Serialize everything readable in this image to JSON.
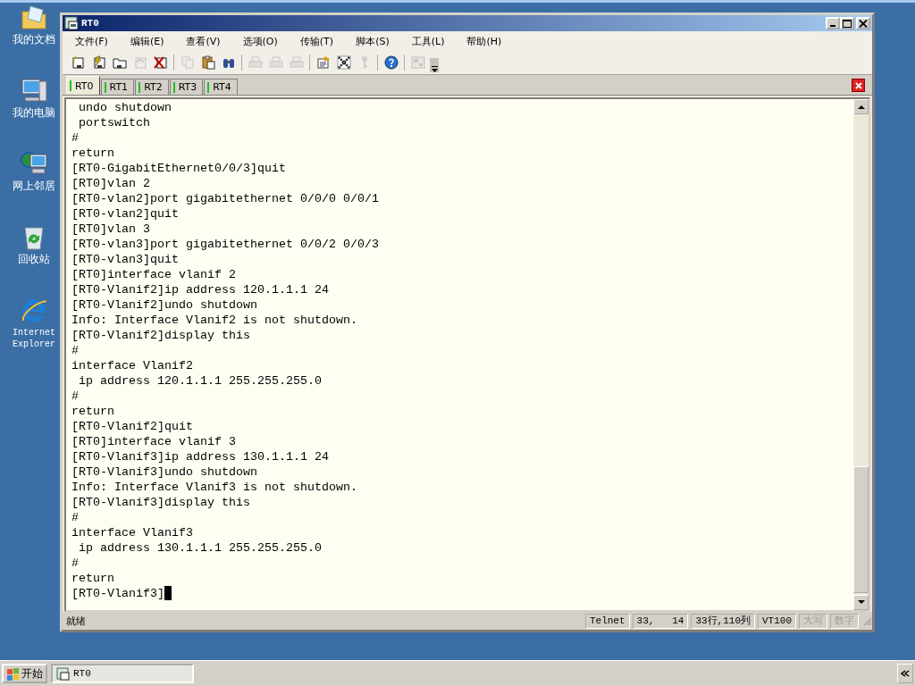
{
  "desktop_icons": [
    {
      "kind": "documents",
      "label": "我的文档"
    },
    {
      "kind": "computer",
      "label": "我的电脑"
    },
    {
      "kind": "network",
      "label": "网上邻居"
    },
    {
      "kind": "recycle",
      "label": "回收站"
    },
    {
      "kind": "browser",
      "label": "Internet Explorer"
    }
  ],
  "window": {
    "title": "RT0"
  },
  "menu": [
    "文件(F)",
    "编辑(E)",
    "查看(V)",
    "选项(O)",
    "传输(T)",
    "脚本(S)",
    "工具(L)",
    "帮助(H)"
  ],
  "toolbar": [
    {
      "kind": "session",
      "disabled": false
    },
    {
      "kind": "lightning",
      "disabled": false
    },
    {
      "kind": "folder",
      "disabled": false
    },
    {
      "kind": "reconnect",
      "disabled": true
    },
    {
      "kind": "disconnect",
      "disabled": false
    },
    {
      "kind": "separator"
    },
    {
      "kind": "copy",
      "disabled": true
    },
    {
      "kind": "paste",
      "disabled": false
    },
    {
      "kind": "binoculars",
      "disabled": false
    },
    {
      "kind": "separator"
    },
    {
      "kind": "printer",
      "disabled": true
    },
    {
      "kind": "printer",
      "disabled": true
    },
    {
      "kind": "printer",
      "disabled": true
    },
    {
      "kind": "separator"
    },
    {
      "kind": "properties",
      "disabled": false
    },
    {
      "kind": "tools",
      "disabled": false
    },
    {
      "kind": "key",
      "disabled": true
    },
    {
      "kind": "separator"
    },
    {
      "kind": "help",
      "disabled": false
    },
    {
      "kind": "separator"
    },
    {
      "kind": "keymap",
      "disabled": true
    }
  ],
  "tabs": [
    {
      "label": "RT0",
      "selected": true
    },
    {
      "label": "RT1",
      "selected": false
    },
    {
      "label": "RT2",
      "selected": false
    },
    {
      "label": "RT3",
      "selected": false
    },
    {
      "label": "RT4",
      "selected": false
    }
  ],
  "terminal": {
    "cursor_visible": true,
    "lines": [
      " undo shutdown",
      " portswitch",
      "#",
      "return",
      "[RT0-GigabitEthernet0/0/3]quit",
      "[RT0]vlan 2",
      "[RT0-vlan2]port gigabitethernet 0/0/0 0/0/1",
      "[RT0-vlan2]quit",
      "[RT0]vlan 3",
      "[RT0-vlan3]port gigabitethernet 0/0/2 0/0/3",
      "[RT0-vlan3]quit",
      "[RT0]interface vlanif 2",
      "[RT0-Vlanif2]ip address 120.1.1.1 24",
      "[RT0-Vlanif2]undo shutdown",
      "Info: Interface Vlanif2 is not shutdown.",
      "[RT0-Vlanif2]display this",
      "#",
      "interface Vlanif2",
      " ip address 120.1.1.1 255.255.255.0",
      "#",
      "return",
      "[RT0-Vlanif2]quit",
      "[RT0]interface vlanif 3",
      "[RT0-Vlanif3]ip address 130.1.1.1 24",
      "[RT0-Vlanif3]undo shutdown",
      "Info: Interface Vlanif3 is not shutdown.",
      "[RT0-Vlanif3]display this",
      "#",
      "interface Vlanif3",
      " ip address 130.1.1.1 255.255.255.0",
      "#",
      "return",
      "[RT0-Vlanif3]"
    ]
  },
  "status_bar": {
    "message": "就绪",
    "panes": [
      {
        "text": "Telnet",
        "disabled": false
      },
      {
        "text": "33,   14",
        "disabled": false
      },
      {
        "text": "33行,110列",
        "disabled": false
      },
      {
        "text": "VT100",
        "disabled": false
      },
      {
        "text": "大写",
        "disabled": true
      },
      {
        "text": "数字",
        "disabled": true
      }
    ]
  },
  "taskbar": {
    "start": "开始",
    "tasks": [
      {
        "label": "RT0",
        "selected": true
      }
    ]
  }
}
